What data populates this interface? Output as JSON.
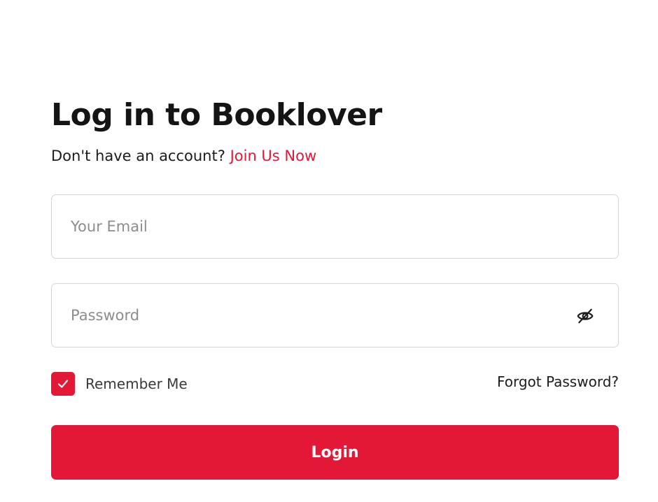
{
  "header": {
    "title": "Log in to Booklover",
    "signup_prompt": "Don't have an account?",
    "signup_link": "Join Us Now"
  },
  "form": {
    "email": {
      "placeholder": "Your Email",
      "value": ""
    },
    "password": {
      "placeholder": "Password",
      "value": "",
      "visibility_icon": "eye-off-icon"
    },
    "remember_label": "Remember Me",
    "remember_checked": true,
    "forgot_label": "Forgot Password?",
    "submit_label": "Login"
  },
  "colors": {
    "accent": "#e31837",
    "text": "#1c1c1c",
    "placeholder": "#8d8d8d",
    "border": "#d6d6d6"
  }
}
